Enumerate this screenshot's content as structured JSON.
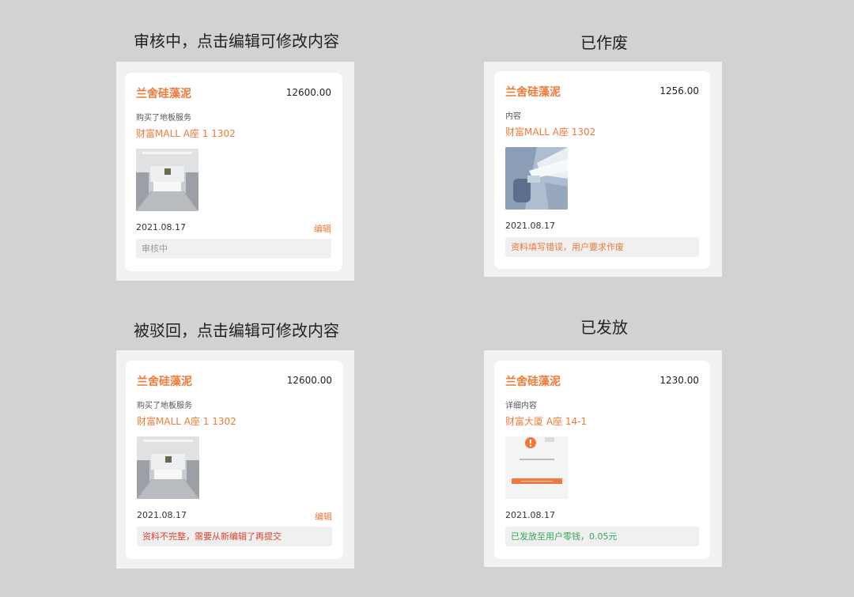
{
  "sections": [
    {
      "title": "审核中，点击编辑可修改内容",
      "card": {
        "shop": "兰舍硅藻泥",
        "amount": "12600.00",
        "desc": "购买了地板服务",
        "address": "财富MALL A座 1 1302",
        "date": "2021.08.17",
        "edit_label": "编辑",
        "status": "审核中"
      }
    },
    {
      "title": "已作废",
      "card": {
        "shop": "兰舍硅藻泥",
        "amount": "1256.00",
        "desc": "内容",
        "address": "财富MALL A座 1302",
        "date": "2021.08.17",
        "status": "资料填写错误，用户要求作废"
      }
    },
    {
      "title": "被驳回，点击编辑可修改内容",
      "card": {
        "shop": "兰舍硅藻泥",
        "amount": "12600.00",
        "desc": "购买了地板服务",
        "address": "财富MALL A座 1 1302",
        "date": "2021.08.17",
        "edit_label": "编辑",
        "status": "资料不完整，需要从新编辑了再提交"
      }
    },
    {
      "title": "已发放",
      "card": {
        "shop": "兰舍硅藻泥",
        "amount": "1230.00",
        "desc": "详细内容",
        "address": "财富大厦 A座 14-1",
        "date": "2021.08.17",
        "status": "已发放至用户零钱，0.05元"
      }
    }
  ],
  "colors": {
    "accent": "#f07838",
    "reject": "#e04030",
    "success": "#2faa5a",
    "pending": "#999999",
    "background": "#d2d2d2"
  }
}
